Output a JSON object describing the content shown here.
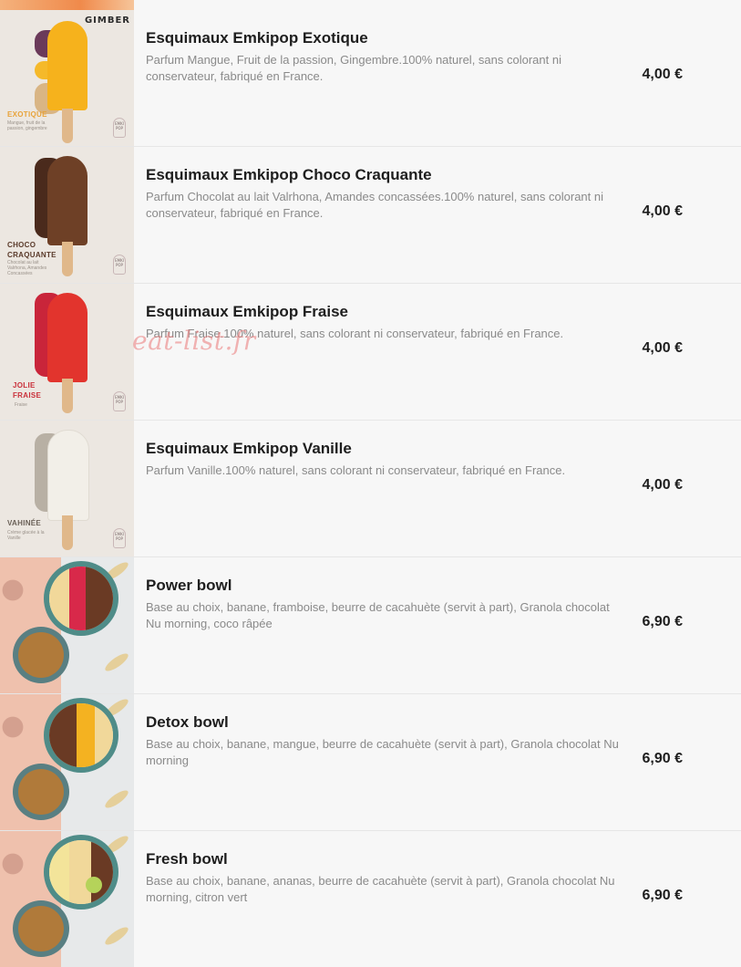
{
  "watermark": "eat-list.fr",
  "items": [
    {
      "title": "Esquimaux Emkipop Exotique",
      "desc": "Parfum Mangue, Fruit de la passion, Gingembre.100% naturel, sans colorant ni conservateur, fabriqué en France.",
      "price": "4,00 €",
      "image": {
        "brand": "GIMBER",
        "label": "EXOTIQUE",
        "sub": "Mangue, fruit de la passion, gingembre",
        "logo": "EMKI POP",
        "label_color": "#e8a33a",
        "pop_color": "#f6b21c"
      }
    },
    {
      "title": "Esquimaux Emkipop Choco Craquante",
      "desc": "Parfum Chocolat au lait Valrhona, Amandes concassées.100% naturel, sans colorant ni conservateur, fabriqué en France.",
      "price": "4,00 €",
      "image": {
        "label": "CHOCO CRAQUANTE",
        "sub": "Chocolat au lait Valrhona, Amandes Concassées",
        "logo": "EMKI POP",
        "label_color": "#5a3a2a",
        "pop_color": "#6e4026"
      }
    },
    {
      "title": "Esquimaux Emkipop Fraise",
      "desc": "Parfum Fraise.100% naturel, sans colorant ni conservateur, fabriqué en France.",
      "price": "4,00 €",
      "image": {
        "label": "JOLIE FRAISE",
        "sub": "Fraise",
        "logo": "EMKI POP",
        "label_color": "#c9303a",
        "pop_color": "#e2342d"
      }
    },
    {
      "title": "Esquimaux Emkipop Vanille",
      "desc": "Parfum Vanille.100% naturel, sans colorant ni conservateur, fabriqué en France.",
      "price": "4,00 €",
      "image": {
        "label": "VAHINÉE",
        "sub": "Crème glacée à la Vanille",
        "logo": "EMKI POP",
        "label_color": "#6b6158",
        "pop_color": "#f2efe8"
      }
    },
    {
      "title": "Power bowl",
      "desc": "Base au choix, banane, framboise, beurre de cacahuète (servit à part), Granola chocolat Nu morning, coco râpée",
      "price": "6,90 €",
      "image": {
        "topping": "#d8294a"
      }
    },
    {
      "title": "Detox bowl",
      "desc": "Base au choix, banane, mangue, beurre de cacahuète (servit à part), Granola chocolat Nu morning",
      "price": "6,90 €",
      "image": {
        "topping": "#f4b221"
      }
    },
    {
      "title": "Fresh bowl",
      "desc": "Base au choix, banane, ananas, beurre de cacahuète (servit à part), Granola chocolat Nu morning, citron vert",
      "price": "6,90 €",
      "image": {
        "topping": "#f3e49a"
      }
    }
  ]
}
